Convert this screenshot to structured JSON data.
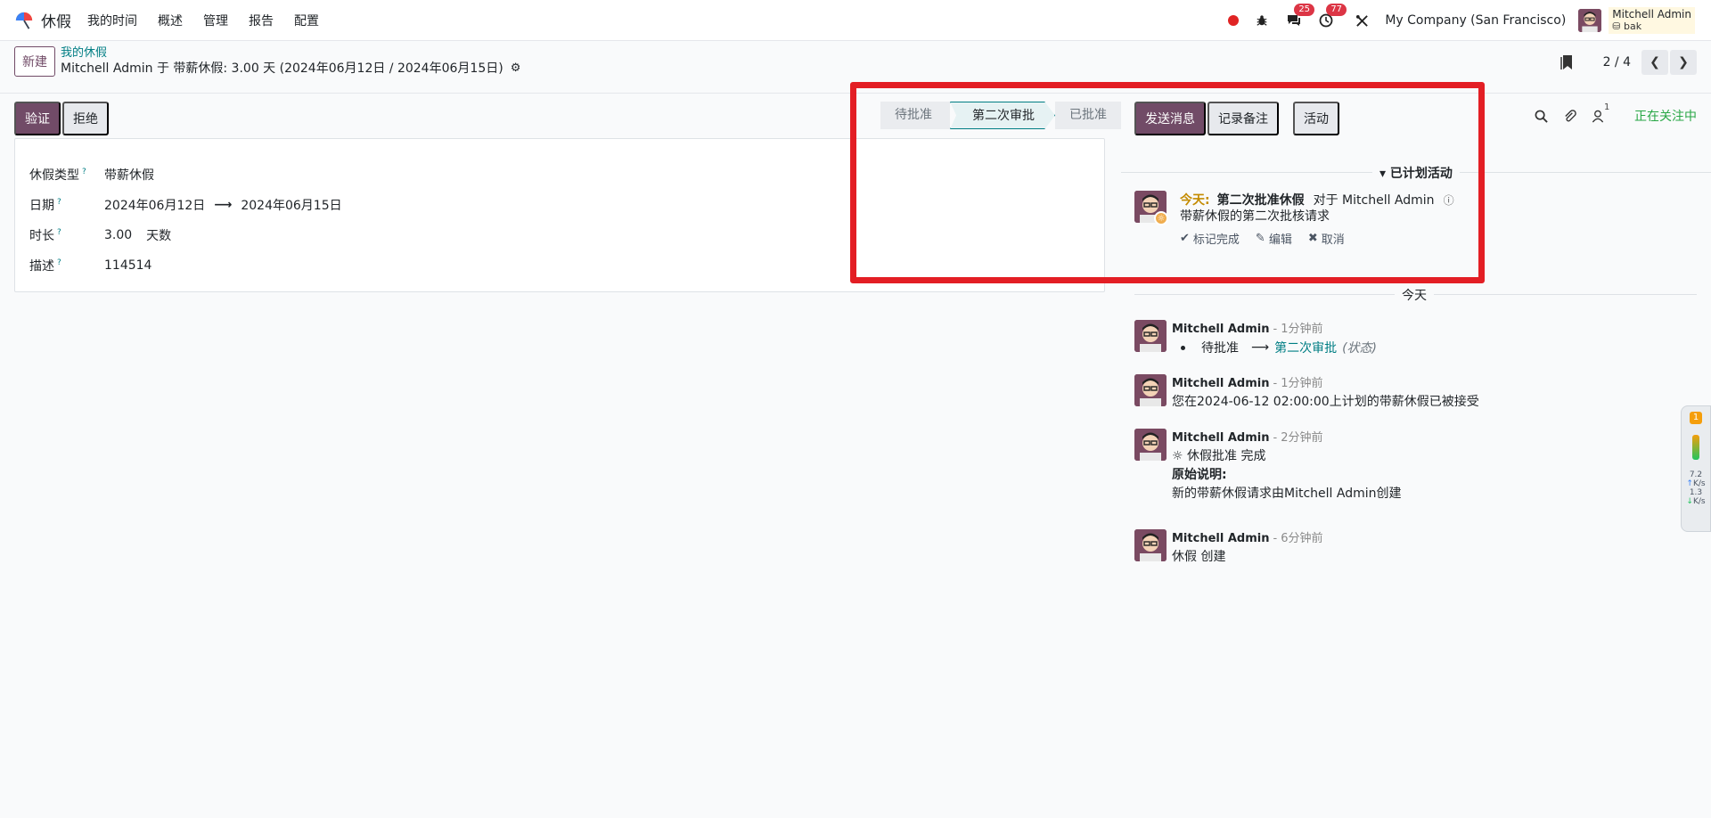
{
  "navbar": {
    "app_name": "休假",
    "menu": [
      "我的时间",
      "概述",
      "管理",
      "报告",
      "配置"
    ],
    "chat_badge": "25",
    "activity_badge": "77",
    "company": "My Company (San Francisco)",
    "user_name": "Mitchell Admin",
    "user_db": "bak"
  },
  "control_panel": {
    "new_label": "新建",
    "breadcrumb_parent": "我的休假",
    "record_title": "Mitchell Admin 于 带薪休假: 3.00 天 (2024年06月12日 / 2024年06月15日)",
    "pager": "2 / 4"
  },
  "actions": {
    "validate": "验证",
    "refuse": "拒绝"
  },
  "status_bar": {
    "stages": [
      "待批准",
      "第二次审批",
      "已批准"
    ],
    "active": "第二次审批"
  },
  "form": {
    "type_label": "休假类型",
    "type_value": "带薪休假",
    "date_label": "日期",
    "date_from": "2024年06月12日",
    "date_to": "2024年06月15日",
    "duration_label": "时长",
    "duration_value": "3.00",
    "duration_unit": "天数",
    "desc_label": "描述",
    "desc_value": "114514",
    "help_mark": "?"
  },
  "chatter": {
    "send_message": "发送消息",
    "log_note": "记录备注",
    "activities": "活动",
    "follower_count": "1",
    "following": "正在关注中",
    "planned_header": "已计划活动",
    "activity": {
      "today": "今天:",
      "title": "第二次批准休假",
      "for": "对于 Mitchell Admin",
      "desc": "带薪休假的第二次批核请求",
      "mark_done": "标记完成",
      "edit": "编辑",
      "cancel": "取消"
    },
    "today_separator": "今天",
    "messages": [
      {
        "author": "Mitchell Admin",
        "time": "- 1分钟前",
        "old": "待批准",
        "new": "第二次审批",
        "field": "(状态)"
      },
      {
        "author": "Mitchell Admin",
        "time": "- 1分钟前",
        "body": "您在2024-06-12 02:00:00上计划的带薪休假已被接受"
      },
      {
        "author": "Mitchell Admin",
        "time": "- 2分钟前",
        "line1": "休假批准 完成",
        "line2": "原始说明:",
        "line3": "新的带薪休假请求由Mitchell Admin创建"
      },
      {
        "author": "Mitchell Admin",
        "time": "- 6分钟前",
        "body": "休假 创建"
      }
    ]
  },
  "side_widget": {
    "badge": "1",
    "up_speed": "7.2",
    "down_speed": "1.3",
    "unit": "K/s"
  },
  "colors": {
    "primary": "#714b67",
    "accent": "#017e84",
    "highlight": "#e31e24",
    "following": "#28a745"
  }
}
